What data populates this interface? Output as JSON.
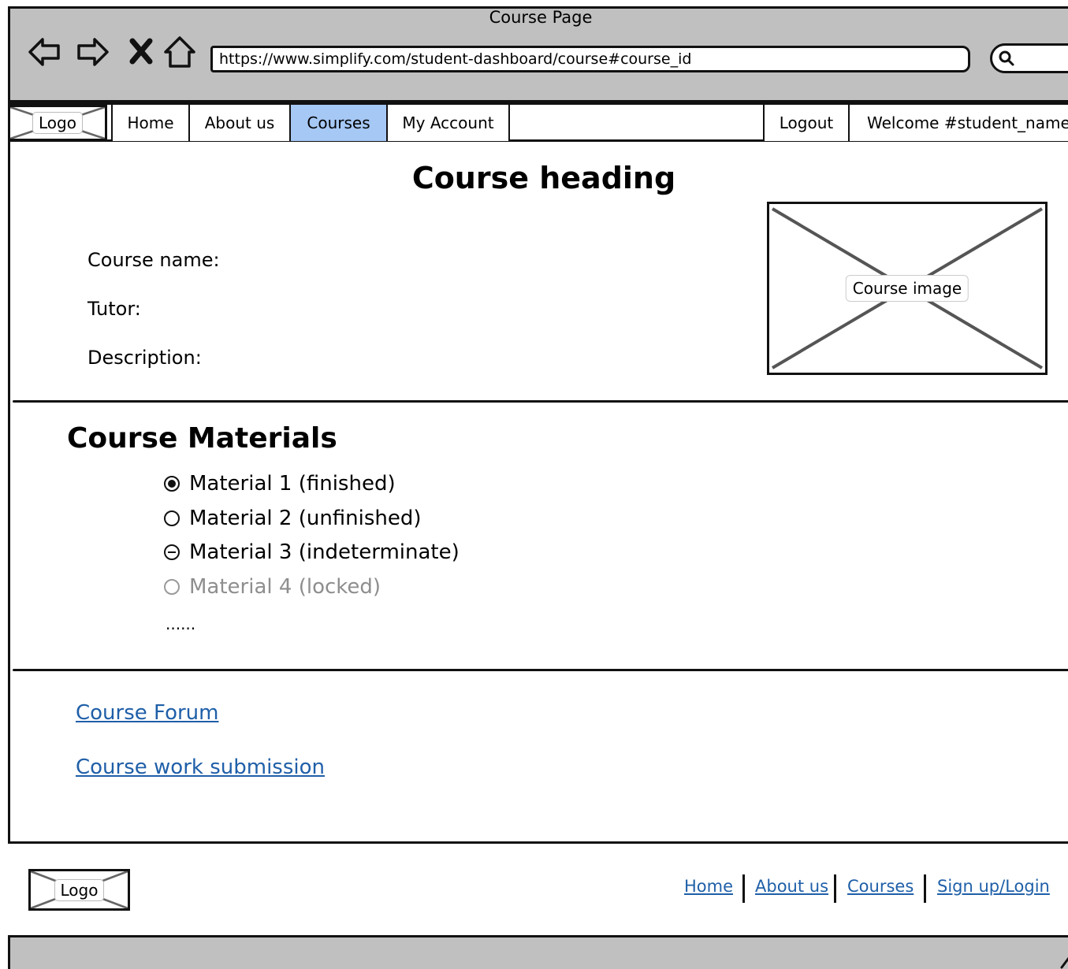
{
  "window": {
    "title": "Course Page",
    "url": "https://www.simplify.com/student-dashboard/course#course_id"
  },
  "nav": {
    "logo": "Logo",
    "items": [
      "Home",
      "About us",
      "Courses",
      "My Account"
    ],
    "active": "Courses",
    "logout": "Logout",
    "welcome": "Welcome #student_name"
  },
  "course": {
    "heading": "Course heading",
    "name_label": "Course name:",
    "tutor_label": "Tutor:",
    "description_label": "Description:",
    "image_label": "Course image"
  },
  "materials": {
    "title": "Course Materials",
    "items": [
      {
        "label": "Material 1 (finished)",
        "state": "checked"
      },
      {
        "label": "Material 2 (unfinished)",
        "state": "unchecked"
      },
      {
        "label": "Material 3 (indeterminate)",
        "state": "indeterminate"
      },
      {
        "label": "Material 4 (locked)",
        "state": "disabled"
      }
    ],
    "more": "......"
  },
  "links": {
    "forum": "Course Forum",
    "submission": "Course work submission"
  },
  "footer": {
    "logo": "Logo",
    "links": [
      "Home",
      "About us",
      "Courses",
      "Sign up/Login"
    ]
  }
}
